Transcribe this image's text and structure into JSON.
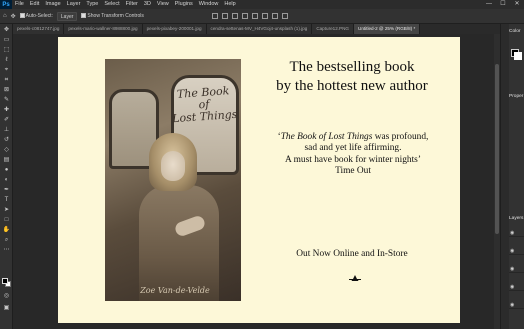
{
  "app": {
    "logo_text": "Ps",
    "menu": [
      "File",
      "Edit",
      "Image",
      "Layer",
      "Type",
      "Select",
      "Filter",
      "3D",
      "View",
      "Plugins",
      "Window",
      "Help"
    ],
    "window_controls": [
      "—",
      "☐",
      "✕"
    ]
  },
  "options_bar": {
    "auto_select_label": "Auto-Select:",
    "auto_select_value": "Layer",
    "show_transform_label": "Show Transform Controls"
  },
  "tabs": [
    {
      "label": "pexels-c0812747.jpg",
      "active": false
    },
    {
      "label": "pexels-mario-wallner-8988800.jpg",
      "active": false
    },
    {
      "label": "pexels-pixabey-200001.jpg",
      "active": false
    },
    {
      "label": "cendra-settenas-MV_H4VGoj4-unsplash (1).jpg",
      "active": false
    },
    {
      "label": "Capture12.PNG",
      "active": false
    },
    {
      "label": "Untitled-2 @ 25% (RGB/8) *",
      "active": true
    }
  ],
  "tools": [
    "move-tool",
    "artboard-tool",
    "marquee-tool",
    "lasso-tool",
    "object-select-tool",
    "crop-tool",
    "frame-tool",
    "eyedropper-tool",
    "spot-heal-tool",
    "brush-tool",
    "stamp-tool",
    "history-brush-tool",
    "eraser-tool",
    "gradient-tool",
    "blur-tool",
    "dodge-tool",
    "pen-tool",
    "type-tool",
    "path-select-tool",
    "shape-tool",
    "hand-tool",
    "zoom-tool",
    "more-tools"
  ],
  "canvas": {
    "book_cover": {
      "title_line1": "The Book of",
      "title_line2": "Lost Things",
      "author": "Zoe Van-de-Velde"
    },
    "headline_line1": "The bestselling book",
    "headline_line2": "by the hottest new author",
    "quote_italic": "The Book of Lost Things",
    "quote_open": "‘",
    "quote_rest_line1": " was profound,",
    "quote_line2": "sad and yet life affirming.",
    "quote_line3": "A must have book for winter nights’",
    "quote_source": "Time Out",
    "cta": "Out Now Online and In-Store"
  },
  "panels": {
    "color_title": "Color",
    "properties_title": "Proper",
    "layers_title": "Layers"
  },
  "colors": {
    "document_bg": "#fdf8d8",
    "ps_blue": "#31a8ff",
    "chrome_dark": "#323232"
  }
}
